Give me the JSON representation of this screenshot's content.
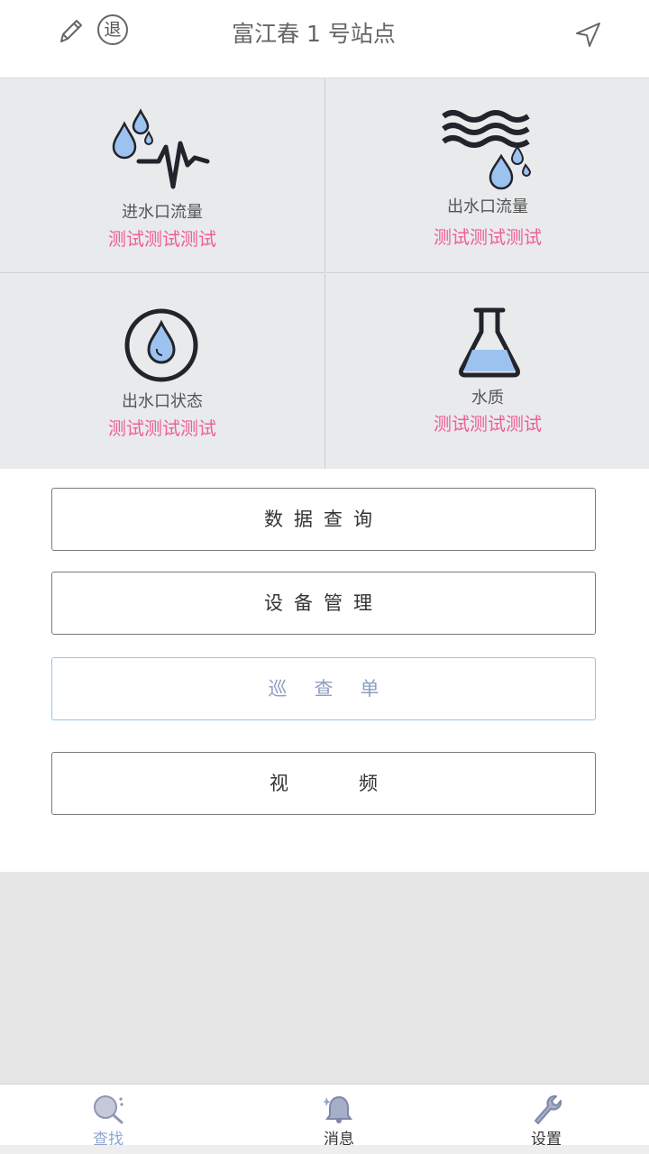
{
  "header": {
    "title": "富江春 1 号站点",
    "logout_label": "退",
    "edit_icon": "pencil-icon",
    "nav_icon": "navigation-arrow-icon"
  },
  "tiles": [
    {
      "label": "进水口流量",
      "value": "测试测试测试",
      "icon": "drops-waveform-icon"
    },
    {
      "label": "出水口流量",
      "value": "测试测试测试",
      "icon": "waves-drops-icon"
    },
    {
      "label": "出水口状态",
      "value": "测试测试测试",
      "icon": "drop-circle-icon"
    },
    {
      "label": "水质",
      "value": "测试测试测试",
      "icon": "flask-icon"
    }
  ],
  "menu": {
    "data_query": "数据查询",
    "device_management": "设备管理",
    "inspection": "巡查单",
    "video": "视频"
  },
  "tabs": [
    {
      "label": "查找",
      "icon": "search-icon",
      "active": true
    },
    {
      "label": "消息",
      "icon": "bell-icon",
      "active": false
    },
    {
      "label": "设置",
      "icon": "wrench-icon",
      "active": false
    }
  ],
  "colors": {
    "accent_pink": "#ee5f93",
    "tile_bg": "#e9eaec",
    "icon_blue": "#9cc3ef",
    "icon_dark": "#22232b",
    "active_tab": "#8fa6d0"
  }
}
